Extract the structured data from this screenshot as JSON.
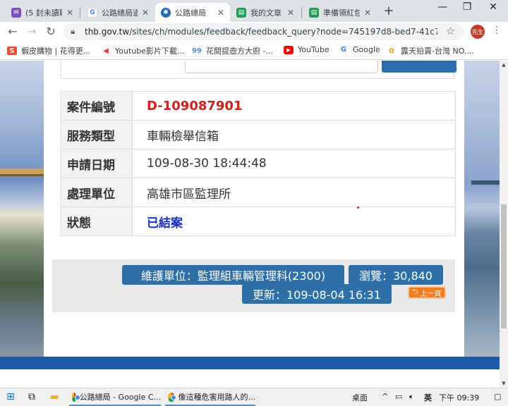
{
  "browser": {
    "tabs": [
      {
        "title": "(5 封未讀取",
        "icon": "gmail-icon",
        "active": false
      },
      {
        "title": "公路總局道",
        "icon": "google-icon",
        "active": false
      },
      {
        "title": "公路總局",
        "icon": "thb-icon",
        "active": true
      },
      {
        "title": "我的文章 -",
        "icon": "sheet-icon",
        "active": false
      },
      {
        "title": "準備領紅包",
        "icon": "sheet-icon",
        "active": false
      }
    ],
    "new_tab": "+",
    "window_controls": {
      "minimize": "—",
      "restore": "❐",
      "close": "✕"
    },
    "address": {
      "host": "thb.gov.tw",
      "path": "/sites/ch/modules/feedback/feedback_query?node=745197d8-bed7-41c7-80..."
    },
    "profile_label": "先生",
    "bookmarks": [
      {
        "label": "蝦皮購物 | 花得更...",
        "icon": "shopee-icon",
        "color": "#ee4d2d"
      },
      {
        "label": "Youtube影片下載...",
        "icon": "download-icon",
        "color": "#e53935"
      },
      {
        "label": "花間提壺方大廚 -...",
        "icon": "blog-icon",
        "color": "#4a90d9"
      },
      {
        "label": "YouTube",
        "icon": "youtube-icon",
        "color": "#ff0000"
      },
      {
        "label": "Google",
        "icon": "google-icon",
        "color": "#4285f4"
      },
      {
        "label": "露天拍賣-台灣 NO....",
        "icon": "ruten-icon",
        "color": "#f4a100"
      }
    ]
  },
  "page": {
    "rows": [
      {
        "label": "案件編號",
        "value": "D-109087901"
      },
      {
        "label": "服務類型",
        "value": "車輛檢舉信箱"
      },
      {
        "label": "申請日期",
        "value": "109-08-30 18:44:48"
      },
      {
        "label": "處理單位",
        "value": "高雄市區監理所"
      },
      {
        "label": "狀態",
        "value": "已結案"
      }
    ],
    "footer": {
      "maintainer": "維護單位：監理組車輛管理科(2300)",
      "views": "瀏覽：30,840",
      "updated": "更新：109-08-04 16:31",
      "prev_button": "上一頁"
    },
    "colors": {
      "case_no": "#d0201c",
      "status": "#1b2fc4",
      "pill": "#2d6fa9",
      "prev": "#ef7d22"
    }
  },
  "taskbar": {
    "apps": [
      {
        "label": "公路總局 - Google C..."
      },
      {
        "label": "像這種危害用路人的..."
      }
    ],
    "tray": {
      "desktop": "桌面",
      "chevron": "^",
      "ime": "英",
      "clock": "下午 09:39"
    }
  }
}
